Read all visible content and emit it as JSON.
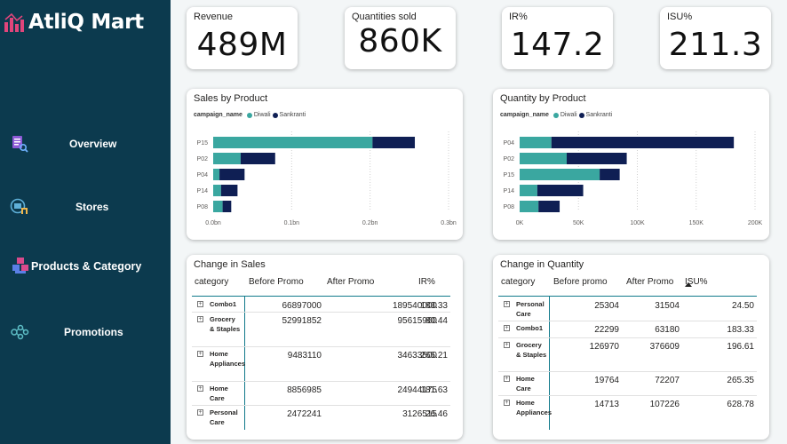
{
  "brand": {
    "name": "AtliQ Mart"
  },
  "nav": [
    {
      "label": "Overview",
      "icon": "report-icon"
    },
    {
      "label": "Stores",
      "icon": "store-icon"
    },
    {
      "label": "Products & Category",
      "icon": "boxes-icon"
    },
    {
      "label": "Promotions",
      "icon": "promotion-icon"
    }
  ],
  "kpis": {
    "revenue": {
      "title": "Revenue",
      "value": "489M"
    },
    "quantities": {
      "title": "Quantities sold",
      "value": "860K"
    },
    "ir": {
      "title": "IR%",
      "value": "147.2"
    },
    "isu": {
      "title": "ISU%",
      "value": "211.3"
    }
  },
  "colors": {
    "sidebar": "#0c3a4e",
    "diwali": "#3aa7a0",
    "sankranti": "#0f1f54"
  },
  "legend": {
    "field": "campaign_name",
    "items": [
      "Diwali",
      "Sankranti"
    ]
  },
  "chart_data": [
    {
      "type": "bar",
      "orientation": "horizontal",
      "stacked": true,
      "title": "Sales by Product",
      "categories": [
        "P15",
        "P02",
        "P04",
        "P14",
        "P08"
      ],
      "series": [
        {
          "name": "Diwali",
          "values": [
            0.203,
            0.035,
            0.008,
            0.01,
            0.012
          ]
        },
        {
          "name": "Sankranti",
          "values": [
            0.054,
            0.044,
            0.032,
            0.021,
            0.011
          ]
        }
      ],
      "xticks": [
        "0.0bn",
        "0.1bn",
        "0.2bn",
        "0.3bn"
      ],
      "xlim": [
        0,
        0.3
      ],
      "xunit": "bn",
      "grid": true,
      "legend_position": "top-left"
    },
    {
      "type": "bar",
      "orientation": "horizontal",
      "stacked": true,
      "title": "Quantity by Product",
      "categories": [
        "P04",
        "P02",
        "P15",
        "P14",
        "P08"
      ],
      "series": [
        {
          "name": "Diwali",
          "values": [
            27000,
            40000,
            68000,
            15000,
            16000
          ]
        },
        {
          "name": "Sankranti",
          "values": [
            155000,
            51000,
            17000,
            39000,
            18000
          ]
        }
      ],
      "xticks": [
        "0K",
        "50K",
        "100K",
        "150K",
        "200K"
      ],
      "xlim": [
        0,
        200000
      ],
      "grid": true,
      "legend_position": "top-left"
    }
  ],
  "sales_table": {
    "title": "Change in Sales",
    "headers": [
      "category",
      "Before Promo",
      "After Promo",
      "IR%"
    ],
    "rows": [
      {
        "category": "Combo1",
        "before": "66897000",
        "after": "189540000",
        "pct": "183.33"
      },
      {
        "category": "Grocery & Staples",
        "before": "52991852",
        "after": "95615960",
        "pct": "80.44"
      },
      {
        "category": "Home Appliances",
        "before": "9483110",
        "after": "34633500",
        "pct": "265.21"
      },
      {
        "category": "Home Care",
        "before": "8856985",
        "after": "24944175",
        "pct": "181.63"
      },
      {
        "category": "Personal Care",
        "before": "2472241",
        "after": "3126515",
        "pct": "26.46"
      }
    ]
  },
  "qty_table": {
    "title": "Change in Quantity",
    "headers": [
      "category",
      "Before promo",
      "After Promo",
      "ISU%"
    ],
    "rows": [
      {
        "category": "Personal Care",
        "before": "25304",
        "after": "31504",
        "pct": "24.50"
      },
      {
        "category": "Combo1",
        "before": "22299",
        "after": "63180",
        "pct": "183.33"
      },
      {
        "category": "Grocery & Staples",
        "before": "126970",
        "after": "376609",
        "pct": "196.61"
      },
      {
        "category": "Home Care",
        "before": "19764",
        "after": "72207",
        "pct": "265.35"
      },
      {
        "category": "Home Appliances",
        "before": "14713",
        "after": "107226",
        "pct": "628.78"
      }
    ]
  }
}
